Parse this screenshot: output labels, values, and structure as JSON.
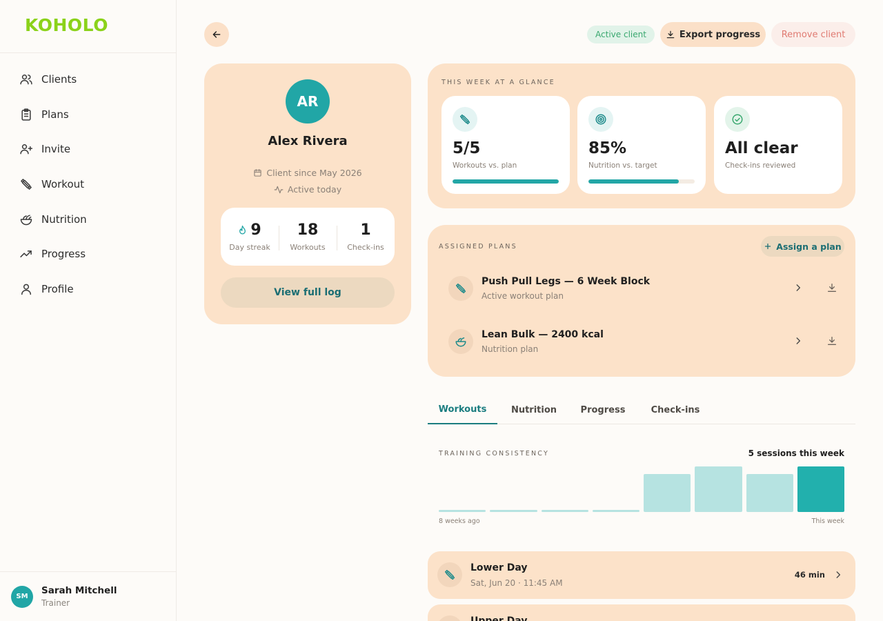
{
  "brand": {
    "logo": "KOHOLO",
    "logo_color": "#8bd21a",
    "accent": "#21a6a6"
  },
  "sidebar": {
    "items": [
      {
        "label": "Clients",
        "icon": "users-icon"
      },
      {
        "label": "Plans",
        "icon": "clipboard-icon"
      },
      {
        "label": "Invite",
        "icon": "user-plus-icon"
      },
      {
        "label": "Workout",
        "icon": "dumbbell-icon"
      },
      {
        "label": "Nutrition",
        "icon": "salad-bowl-icon"
      },
      {
        "label": "Progress",
        "icon": "trending-up-icon"
      },
      {
        "label": "Profile",
        "icon": "user-icon"
      }
    ],
    "user": {
      "initials": "SM",
      "name": "Sarah Mitchell",
      "role": "Trainer"
    }
  },
  "header": {
    "status": "Active client",
    "export_label": "Export progress",
    "remove_label": "Remove client"
  },
  "client": {
    "initials": "AR",
    "name": "Alex Rivera",
    "since": "Client since May 2026",
    "activity": "Active today",
    "stats": [
      {
        "value": "9",
        "label": "Day streak"
      },
      {
        "value": "18",
        "label": "Workouts"
      },
      {
        "value": "1",
        "label": "Check-ins"
      }
    ],
    "view_log_label": "View full log"
  },
  "glance": {
    "title": "THIS WEEK AT A GLANCE",
    "cards": [
      {
        "value": "5/5",
        "label": "Workouts vs. plan",
        "progress": 1.0,
        "icon": "dumbbell-icon"
      },
      {
        "value": "85%",
        "label": "Nutrition vs. target",
        "progress": 0.85,
        "icon": "target-icon"
      },
      {
        "value": "All clear",
        "label": "Check-ins reviewed",
        "icon": "check-circle-icon"
      }
    ]
  },
  "plans": {
    "title": "ASSIGNED PLANS",
    "assign_label": "Assign a plan",
    "items": [
      {
        "title": "Push Pull Legs — 6 Week Block",
        "subtitle": "Active workout plan",
        "icon": "dumbbell-icon"
      },
      {
        "title": "Lean Bulk — 2400 kcal",
        "subtitle": "Nutrition plan",
        "icon": "salad-bowl-icon"
      }
    ]
  },
  "tabs": [
    "Workouts",
    "Nutrition",
    "Progress",
    "Check-ins"
  ],
  "active_tab": "Workouts",
  "consistency": {
    "title": "TRAINING CONSISTENCY",
    "summary": "5 sessions this week",
    "start_label": "8 weeks ago",
    "end_label": "This week"
  },
  "chart_data": {
    "type": "bar",
    "categories": [
      "",
      "",
      "",
      "",
      "",
      "",
      "",
      ""
    ],
    "values": [
      0,
      0,
      0,
      0,
      4,
      5,
      4,
      5
    ],
    "ylim": [
      0,
      5
    ],
    "grid": false,
    "bar_color": "#b6e3e1",
    "highlight_color": "#22b0ad",
    "xlabel": "",
    "ylabel": ""
  },
  "sessions": [
    {
      "title": "Lower Day",
      "subtitle": "Sat, Jun 20 · 11:45 AM",
      "duration": "46 min"
    },
    {
      "title": "Upper Day",
      "subtitle": "",
      "duration": ""
    }
  ]
}
